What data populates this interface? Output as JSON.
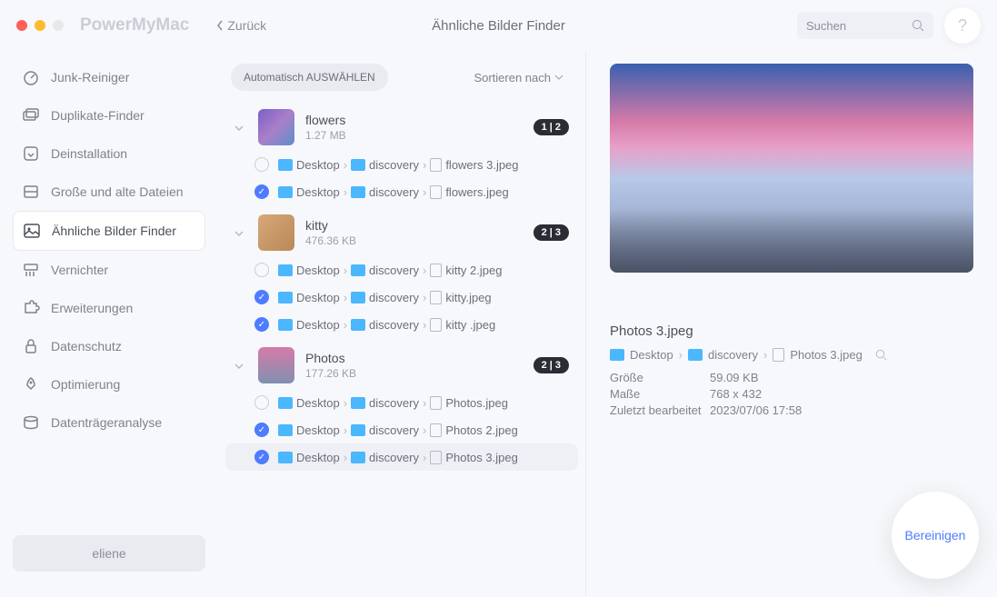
{
  "app_name": "PowerMyMac",
  "back_label": "Zurück",
  "page_title": "Ähnliche Bilder Finder",
  "search_placeholder": "Suchen",
  "help_char": "?",
  "sidebar": {
    "items": [
      {
        "label": "Junk-Reiniger",
        "icon": "gauge"
      },
      {
        "label": "Duplikate-Finder",
        "icon": "folders"
      },
      {
        "label": "Deinstallation",
        "icon": "app"
      },
      {
        "label": "Große und alte Dateien",
        "icon": "drawer"
      },
      {
        "label": "Ähnliche Bilder Finder",
        "icon": "image",
        "active": true
      },
      {
        "label": "Vernichter",
        "icon": "shredder"
      },
      {
        "label": "Erweiterungen",
        "icon": "puzzle"
      },
      {
        "label": "Datenschutz",
        "icon": "lock"
      },
      {
        "label": "Optimierung",
        "icon": "rocket"
      },
      {
        "label": "Datenträgeranalyse",
        "icon": "disk"
      }
    ],
    "user": "eliene"
  },
  "toolbar": {
    "auto_select": "Automatisch AUSWÄHLEN",
    "sort_by": "Sortieren nach"
  },
  "groups": [
    {
      "name": "flowers",
      "size": "1.27 MB",
      "badge": "1 | 2",
      "thumb": "flowers",
      "files": [
        {
          "checked": false,
          "path": [
            "Desktop",
            "discovery"
          ],
          "file": "flowers 3.jpeg"
        },
        {
          "checked": true,
          "path": [
            "Desktop",
            "discovery"
          ],
          "file": "flowers.jpeg"
        }
      ]
    },
    {
      "name": "kitty",
      "size": "476.36 KB",
      "badge": "2 | 3",
      "thumb": "kitty",
      "files": [
        {
          "checked": false,
          "path": [
            "Desktop",
            "discovery"
          ],
          "file": "kitty 2.jpeg"
        },
        {
          "checked": true,
          "path": [
            "Desktop",
            "discovery"
          ],
          "file": "kitty.jpeg"
        },
        {
          "checked": true,
          "path": [
            "Desktop",
            "discovery"
          ],
          "file": "kitty .jpeg"
        }
      ]
    },
    {
      "name": "Photos",
      "size": "177.26 KB",
      "badge": "2 | 3",
      "thumb": "photos",
      "files": [
        {
          "checked": false,
          "path": [
            "Desktop",
            "discovery"
          ],
          "file": "Photos.jpeg"
        },
        {
          "checked": true,
          "path": [
            "Desktop",
            "discovery"
          ],
          "file": "Photos 2.jpeg"
        },
        {
          "checked": true,
          "path": [
            "Desktop",
            "discovery"
          ],
          "file": "Photos 3.jpeg",
          "selected": true
        }
      ]
    }
  ],
  "preview": {
    "filename": "Photos 3.jpeg",
    "path": [
      "Desktop",
      "discovery",
      "Photos 3.jpeg"
    ],
    "meta": {
      "size_k": "Größe",
      "size_v": "59.09 KB",
      "dim_k": "Maße",
      "dim_v": "768 x 432",
      "mod_k": "Zuletzt bearbeitet",
      "mod_v": "2023/07/06 17:58"
    }
  },
  "clean_btn": "Bereinigen"
}
